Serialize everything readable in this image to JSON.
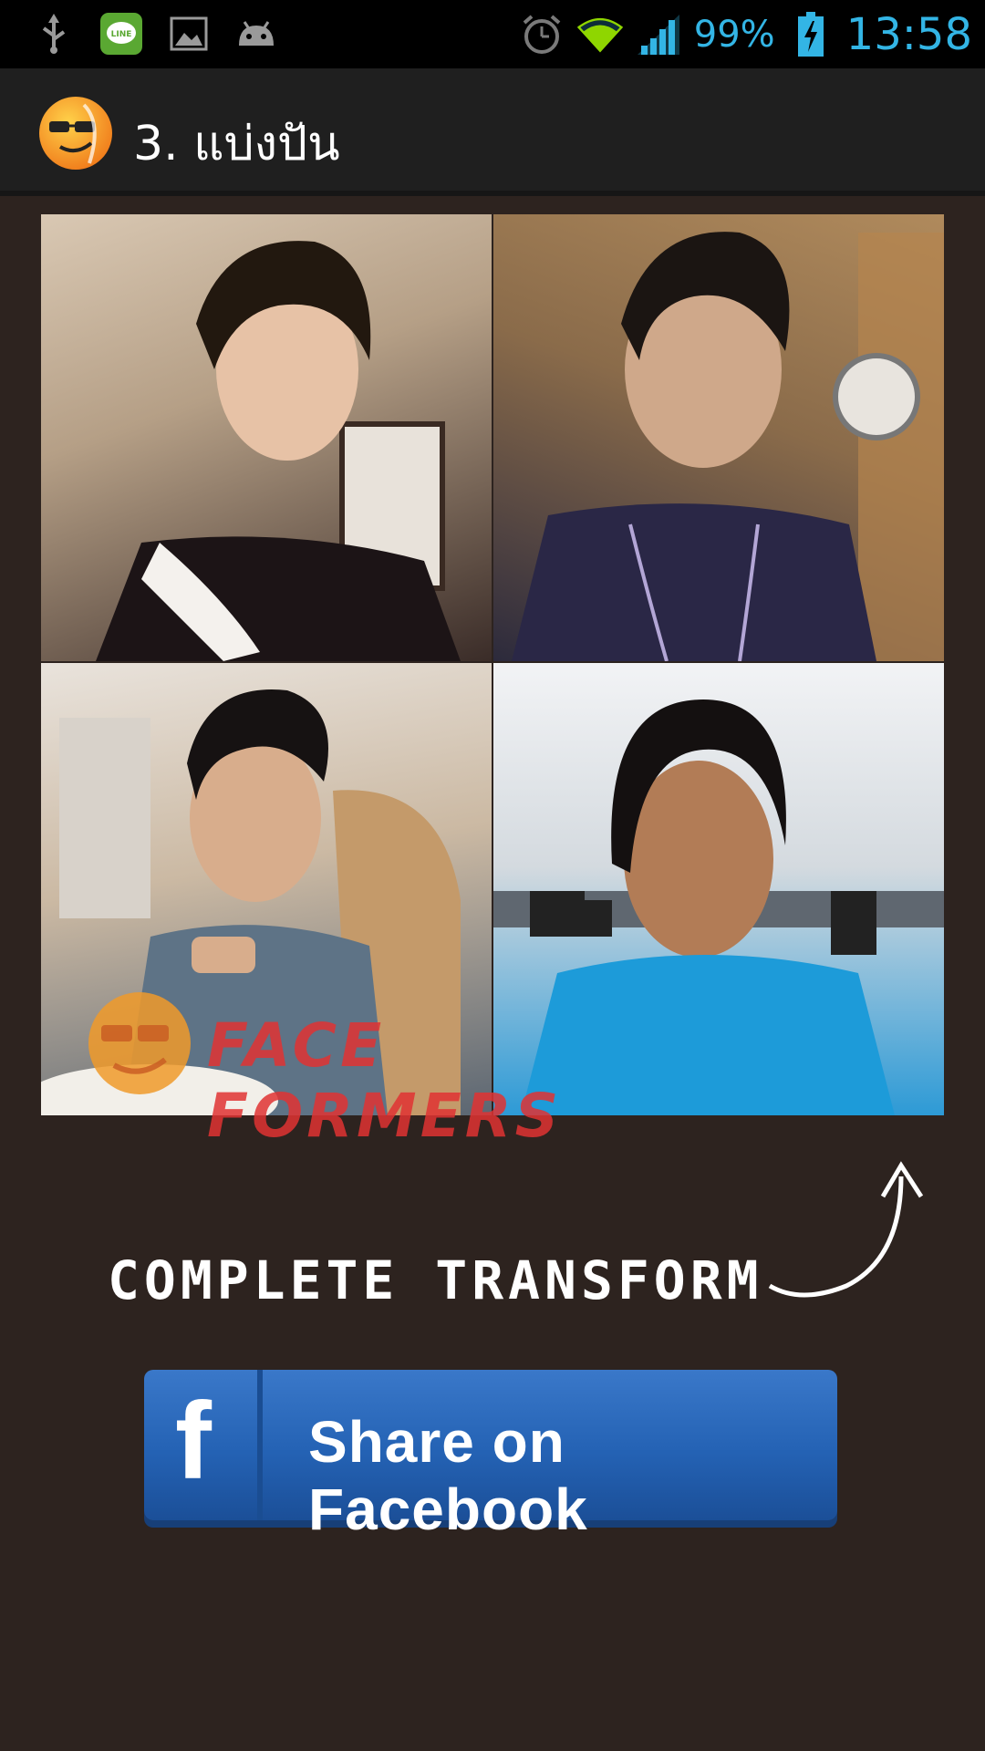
{
  "status_bar": {
    "left_icons": [
      "usb-icon",
      "line-app-icon",
      "gallery-icon",
      "android-icon"
    ],
    "right_icons": [
      "alarm-icon",
      "wifi-icon",
      "signal-icon",
      "battery-charging-icon"
    ],
    "battery_percent": "99%",
    "time": "13:58",
    "accent_color": "#33b5e5"
  },
  "action_bar": {
    "title": "3. แบ่งปัน",
    "logo_icon": "faceformers-logo-icon"
  },
  "photo_grid": {
    "photos": [
      "photo-1",
      "photo-2",
      "photo-3",
      "photo-4"
    ],
    "watermark_text": "FACE FORMERS"
  },
  "main": {
    "complete_text": "COMPLETE TRANSFORM",
    "share_button_label": "Share on Facebook",
    "share_button_icon": "facebook-f-icon",
    "share_button_color": "#2462b4"
  }
}
